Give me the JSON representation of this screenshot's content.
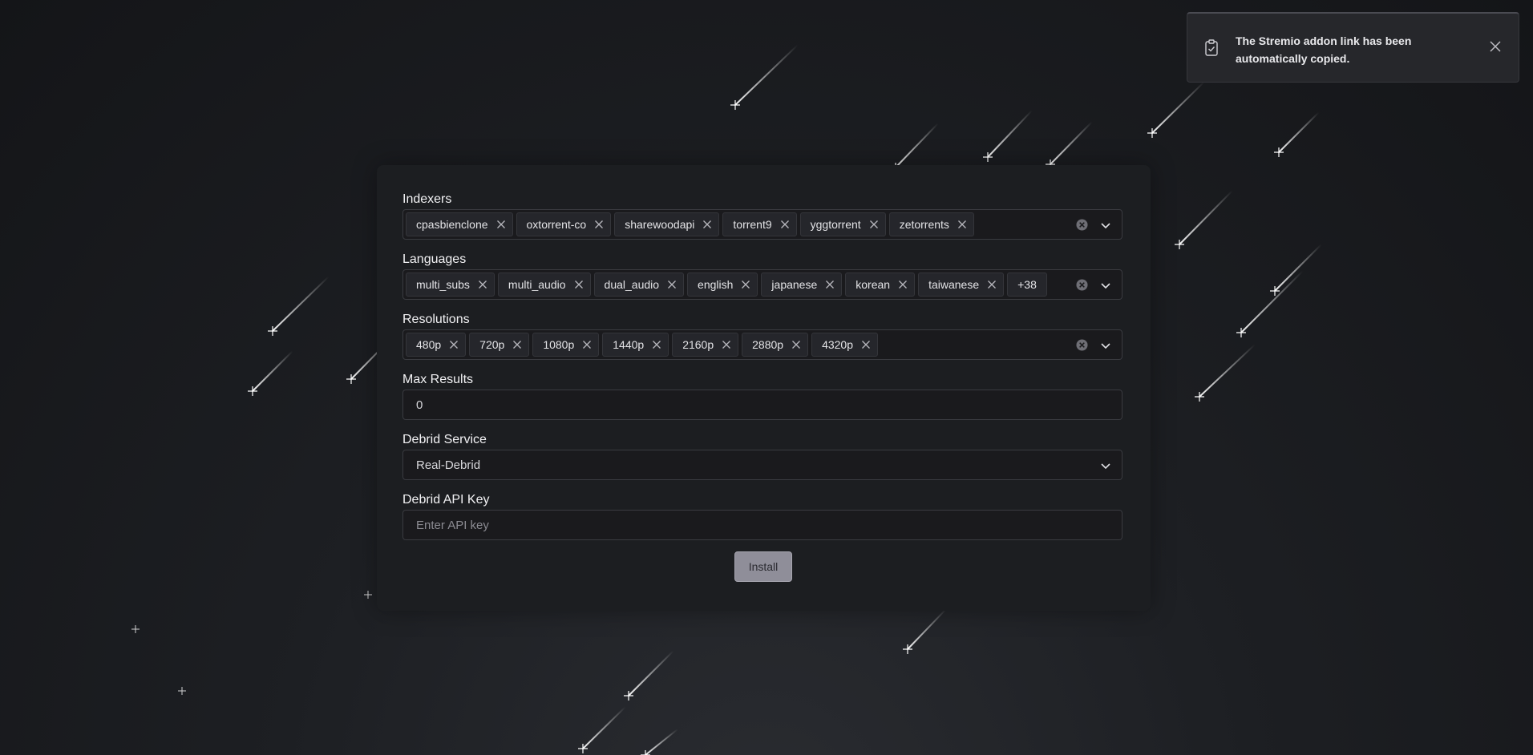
{
  "toast": {
    "message": "The Stremio addon link has been automatically copied."
  },
  "form": {
    "indexers": {
      "label": "Indexers",
      "tags": [
        "cpasbienclone",
        "oxtorrent-co",
        "sharewoodapi",
        "torrent9",
        "yggtorrent",
        "zetorrents"
      ]
    },
    "languages": {
      "label": "Languages",
      "tags": [
        "multi_subs",
        "multi_audio",
        "dual_audio",
        "english",
        "japanese",
        "korean",
        "taiwanese"
      ],
      "more": "+38"
    },
    "resolutions": {
      "label": "Resolutions",
      "tags": [
        "480p",
        "720p",
        "1080p",
        "1440p",
        "2160p",
        "2880p",
        "4320p"
      ]
    },
    "max_results": {
      "label": "Max Results",
      "value": "0"
    },
    "debrid_service": {
      "label": "Debrid Service",
      "value": "Real-Debrid"
    },
    "debrid_api_key": {
      "label": "Debrid API Key",
      "placeholder": "Enter API key"
    },
    "install_label": "Install"
  },
  "icons": {
    "toast": "clipboard-check-icon",
    "toast_close": "close-icon",
    "tag_remove": "x-icon",
    "clear": "clear-circle-icon",
    "dropdown": "chevron-down-icon"
  },
  "colors": {
    "background": "#1d1f23",
    "card": "#1c1e21",
    "field": "#1a1a1d",
    "tag": "#25262b",
    "button": "#8f8e99",
    "toast": "#26272b"
  }
}
